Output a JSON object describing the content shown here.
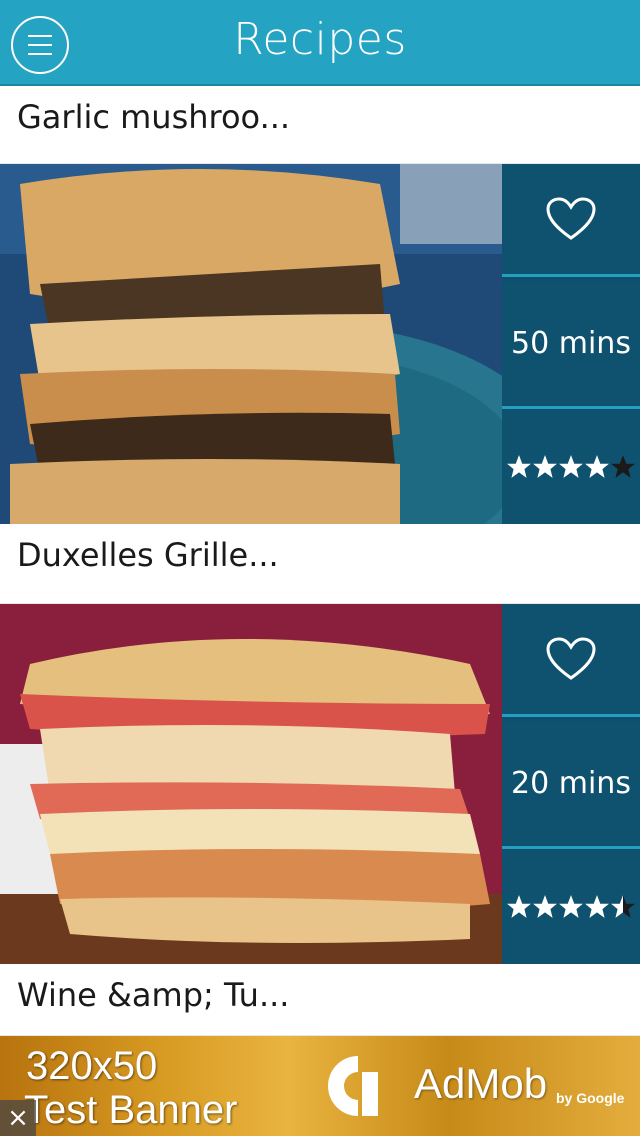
{
  "header": {
    "title": "Recipes"
  },
  "icons": {
    "menu": "menu-icon",
    "favorite": "heart-icon",
    "star": "star-icon",
    "close": "close-icon"
  },
  "colors": {
    "header": "#25a3c2",
    "side_panel": "#0f5270",
    "divider": "#23a0bf"
  },
  "recipes": [
    {
      "title": "Garlic mushroo..."
    },
    {
      "title": "Duxelles Grille...",
      "time": "50 mins",
      "rating": 4.0
    },
    {
      "title": "Wine &amp; Tu...",
      "time": "20 mins",
      "rating": 4.5
    }
  ],
  "ad": {
    "line1": "320x50",
    "line2": "Test Banner",
    "brand": "AdMob",
    "by": "by Google"
  }
}
